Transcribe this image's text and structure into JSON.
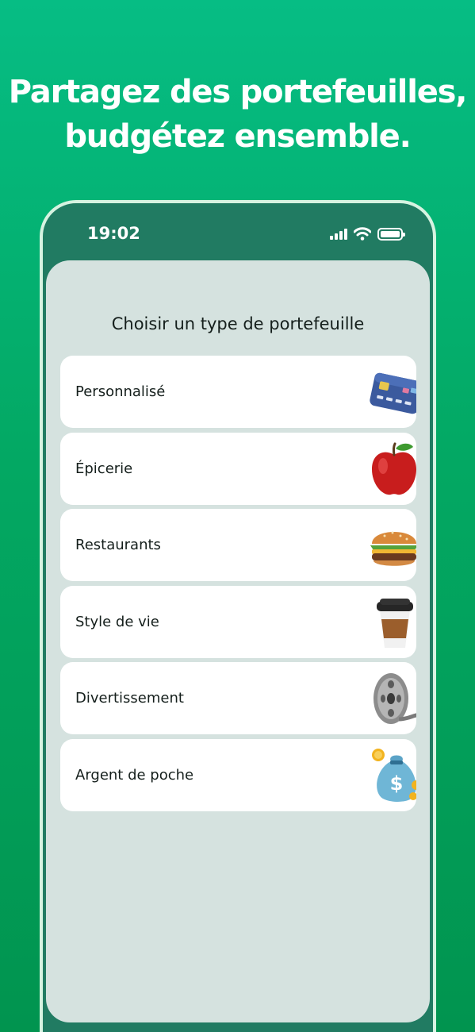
{
  "headline": {
    "line1": "Partagez des portefeuilles,",
    "line2": "budgétez ensemble."
  },
  "status_bar": {
    "time": "19:02",
    "icons": [
      "signal-icon",
      "wifi-icon",
      "battery-icon"
    ]
  },
  "screen": {
    "title": "Choisir un type de portefeuille",
    "wallet_types": [
      {
        "label": "Personnalisé",
        "icon": "credit-card-icon"
      },
      {
        "label": "Épicerie",
        "icon": "apple-icon"
      },
      {
        "label": "Restaurants",
        "icon": "burger-icon"
      },
      {
        "label": "Style de vie",
        "icon": "coffee-cup-icon"
      },
      {
        "label": "Divertissement",
        "icon": "film-reel-icon"
      },
      {
        "label": "Argent de poche",
        "icon": "money-bag-icon"
      }
    ]
  },
  "colors": {
    "background_top": "#06bd84",
    "background_bottom": "#01944f",
    "phone_frame": "#217b62",
    "screen_background": "#d5e2df",
    "card_background": "#ffffff"
  }
}
